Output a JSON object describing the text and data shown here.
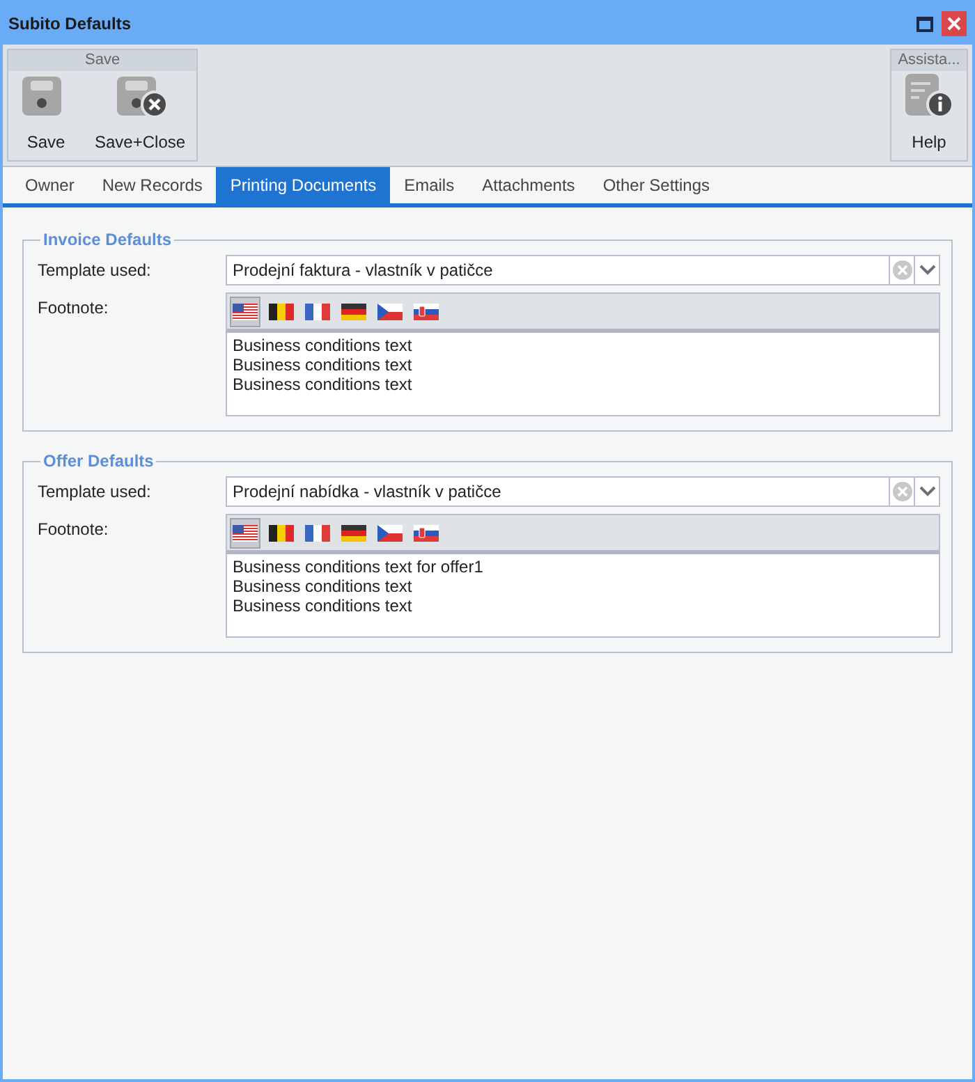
{
  "window": {
    "title": "Subito Defaults"
  },
  "ribbon": {
    "groups": [
      {
        "title": "Save",
        "buttons": [
          {
            "kind": "save",
            "label": "Save"
          },
          {
            "kind": "save-close",
            "label": "Save+Close"
          }
        ]
      },
      {
        "title": "Assista...",
        "buttons": [
          {
            "kind": "help",
            "label": "Help"
          }
        ]
      }
    ]
  },
  "tabs": [
    {
      "label": "Owner",
      "selected": false
    },
    {
      "label": "New Records",
      "selected": false
    },
    {
      "label": "Printing Documents",
      "selected": true
    },
    {
      "label": "Emails",
      "selected": false
    },
    {
      "label": "Attachments",
      "selected": false
    },
    {
      "label": "Other Settings",
      "selected": false
    }
  ],
  "sections": [
    {
      "title": "Invoice Defaults",
      "template_label": "Template used:",
      "template_value": "Prodejní faktura - vlastník v patičce",
      "footnote_label": "Footnote:",
      "flags": [
        {
          "kind": "us",
          "selected": true
        },
        {
          "kind": "be",
          "selected": false
        },
        {
          "kind": "fr",
          "selected": false
        },
        {
          "kind": "de",
          "selected": false
        },
        {
          "kind": "cz",
          "selected": false
        },
        {
          "kind": "sk",
          "selected": false
        }
      ],
      "footnote_lines": [
        "Business conditions text",
        "Business conditions text",
        "Business conditions text"
      ]
    },
    {
      "title": "Offer Defaults",
      "template_label": "Template used:",
      "template_value": "Prodejní nabídka - vlastník v patičce",
      "footnote_label": "Footnote:",
      "flags": [
        {
          "kind": "us",
          "selected": true
        },
        {
          "kind": "be",
          "selected": false
        },
        {
          "kind": "fr",
          "selected": false
        },
        {
          "kind": "de",
          "selected": false
        },
        {
          "kind": "cz",
          "selected": false
        },
        {
          "kind": "sk",
          "selected": false
        }
      ],
      "footnote_lines": [
        "Business conditions text for offer1",
        "Business conditions text",
        "Business conditions text"
      ]
    }
  ]
}
